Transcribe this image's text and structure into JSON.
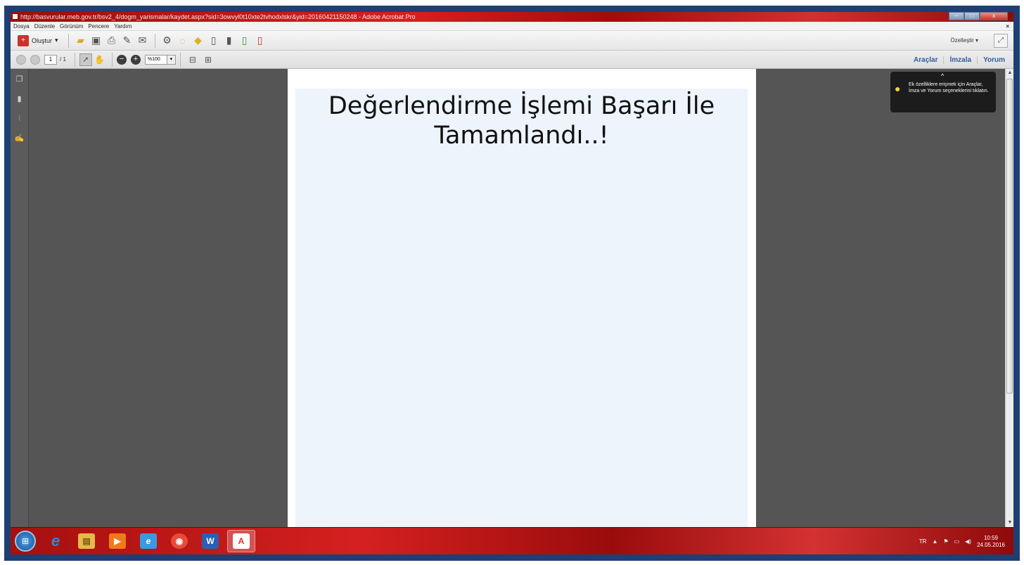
{
  "window": {
    "title": "http://basvurular.meb.gov.tr/bsv2_4/dogm_yarismalar/kaydet.aspx?sid=3owvyl0t10xte2tvhodxlskr&yid=20160421150248 - Adobe Acrobat Pro",
    "minimize": "–",
    "maximize": "□",
    "close": "x"
  },
  "menu": {
    "items": [
      "Dosya",
      "Düzenle",
      "Görünüm",
      "Pencere",
      "Yardım"
    ],
    "close_doc": "×"
  },
  "toolbar": {
    "create_label": "Oluştur",
    "create_caret": "▾",
    "customize_label": "Özelleştir",
    "customize_caret": "▾"
  },
  "navigation": {
    "current_page": "1",
    "total_pages": "/ 1",
    "zoom_value": "%100",
    "zoom_caret": "▾"
  },
  "panels": {
    "tools": "Araçlar",
    "sign": "İmzala",
    "comment": "Yorum"
  },
  "tooltip": {
    "text": "Ek özelliklere erişmek için Araçlar, İmza ve Yorum seçeneklerini tıklatın.",
    "caret": "^"
  },
  "document": {
    "heading_line1": "Değerlendirme İşlemi Başarı İle",
    "heading_line2": "Tamamlandı..!"
  },
  "taskbar": {
    "apps": [
      {
        "name": "internet-explorer",
        "glyph": "e",
        "color": "#2a8ad8"
      },
      {
        "name": "file-explorer",
        "glyph": "▤",
        "color": "#e6b84a"
      },
      {
        "name": "media-player",
        "glyph": "▶",
        "color": "#f07a1a"
      },
      {
        "name": "internet-explorer-2",
        "glyph": "e",
        "color": "#3a9ae0"
      },
      {
        "name": "chrome",
        "glyph": "◉",
        "color": "#e94a3a"
      },
      {
        "name": "word",
        "glyph": "W",
        "color": "#2b5fb6"
      },
      {
        "name": "acrobat",
        "glyph": "A",
        "color": "#d9302a"
      }
    ],
    "language": "TR",
    "time": "10:59",
    "date": "24.05.2016"
  }
}
